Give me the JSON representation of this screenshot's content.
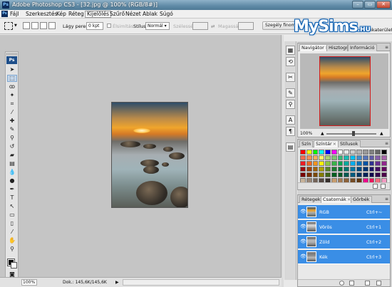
{
  "window": {
    "title": "Adobe Photoshop CS3 - [32.jpg @ 100% (RGB/8#)]",
    "logo": "MySims",
    "logo_suffix": ".HU"
  },
  "menus": [
    "Fájl",
    "Szerkesztés",
    "Kép",
    "Réteg",
    "Kijelölés",
    "Szűrő",
    "Nézet",
    "Ablak",
    "Súgó"
  ],
  "active_menu": "Kijelölés",
  "options": {
    "feather_label": "Lágy perem:",
    "feather_value": "0 kpt",
    "antialias_label": "Élsimítás",
    "style_label": "Stílus:",
    "style_value": "Normál",
    "width_label": "Szélesség:",
    "height_label": "Magasság:",
    "refine_button": "Szegély finomí...",
    "workspace_label": "Munkaterület"
  },
  "status": {
    "zoom": "100%",
    "doc_info": "Dok.: 145,6K/145,6K"
  },
  "navigator": {
    "tabs": [
      "Navigátor",
      "Hisztogram",
      "Információ"
    ],
    "zoom": "100%"
  },
  "swatches": {
    "tabs": [
      "Szín",
      "Színtár",
      "Stílusok"
    ],
    "colors": [
      "#ff0000",
      "#ffff00",
      "#00ff00",
      "#00ffff",
      "#0000ff",
      "#ff00ff",
      "#ffffff",
      "#e6e6e6",
      "#cccccc",
      "#b3b3b3",
      "#999999",
      "#808080",
      "#666666",
      "#000000",
      "#f26c4f",
      "#f68e55",
      "#fbaf5c",
      "#fff467",
      "#acd372",
      "#7cc576",
      "#3bb878",
      "#1abbb4",
      "#00bff3",
      "#438ccb",
      "#5574b9",
      "#605ca8",
      "#855fa8",
      "#a763a8",
      "#ed1c24",
      "#f26522",
      "#f7941d",
      "#fff200",
      "#8dc73f",
      "#39b54a",
      "#00a651",
      "#00a99d",
      "#00aeef",
      "#0072bc",
      "#0054a6",
      "#2e3192",
      "#662d91",
      "#92278f",
      "#9e0b0f",
      "#a0410d",
      "#a3620a",
      "#aba000",
      "#598527",
      "#1a7b30",
      "#007236",
      "#00746b",
      "#0076a3",
      "#004b80",
      "#003471",
      "#1b1464",
      "#440e62",
      "#630460",
      "#790000",
      "#7b2e00",
      "#7d4900",
      "#827b00",
      "#406618",
      "#005e20",
      "#005826",
      "#005952",
      "#005b7f",
      "#003663",
      "#002157",
      "#0d004c",
      "#32004b",
      "#4b0049",
      "#c7b299",
      "#998675",
      "#736357",
      "#534741",
      "#37302d",
      "#c69c6d",
      "#a67c52",
      "#8c6239",
      "#754c24",
      "#603913",
      "#ec008c",
      "#ed145b",
      "#f26d7d",
      "#f49ac2"
    ]
  },
  "channels": {
    "tabs": [
      "Rétegek",
      "Csatornák",
      "Görbék"
    ],
    "rows": [
      {
        "name": "RGB",
        "shortcut": "Ctrl+~"
      },
      {
        "name": "Vörös",
        "shortcut": "Ctrl+1"
      },
      {
        "name": "Zöld",
        "shortcut": "Ctrl+2"
      },
      {
        "name": "Kék",
        "shortcut": "Ctrl+3"
      }
    ]
  }
}
